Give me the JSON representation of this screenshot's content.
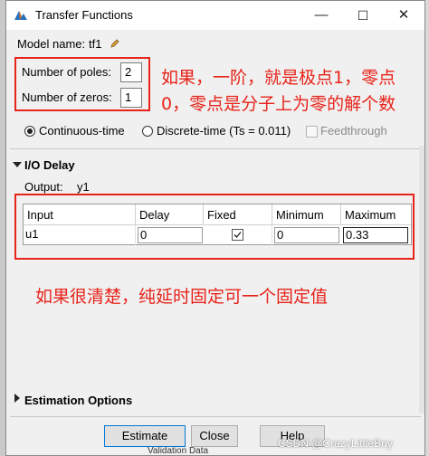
{
  "window": {
    "title": "Transfer Functions",
    "controls": {
      "minimize": "—",
      "maximize": "☐",
      "close": "✕"
    }
  },
  "model": {
    "label": "Model name:",
    "name": "tf1"
  },
  "poles": {
    "label": "Number of poles:",
    "value": "2"
  },
  "zeros": {
    "label": "Number of zeros:",
    "value": "1"
  },
  "time_domain": {
    "continuous_label": "Continuous-time",
    "discrete_label": "Discrete-time (Ts = 0.011)",
    "feedthrough_label": "Feedthrough",
    "selected": "continuous"
  },
  "io_delay": {
    "section_label": "I/O Delay",
    "output_label": "Output:",
    "output_value": "y1",
    "columns": [
      "Input",
      "Delay",
      "Fixed",
      "Minimum",
      "Maximum"
    ],
    "rows": [
      {
        "input": "u1",
        "delay": "0",
        "fixed": true,
        "minimum": "0",
        "maximum": "0.33"
      }
    ]
  },
  "annotations": {
    "note1_line1": "如果，一阶，就是极点1，零点",
    "note1_line2": "0，零点是分子上为零的解个数",
    "note2": "如果很清楚，纯延时固定可一个固定值"
  },
  "estimation_options": {
    "label": "Estimation Options"
  },
  "buttons": {
    "estimate": "Estimate",
    "close": "Close",
    "help": "Help"
  },
  "background": {
    "bottom_text": "Validation Data",
    "watermark": "CSDN @CrazyLittleBoy"
  },
  "colors": {
    "annotation_red": "#e8231a",
    "window_bg": "#f0f0f0",
    "titlebar_bg": "#ffffff"
  }
}
